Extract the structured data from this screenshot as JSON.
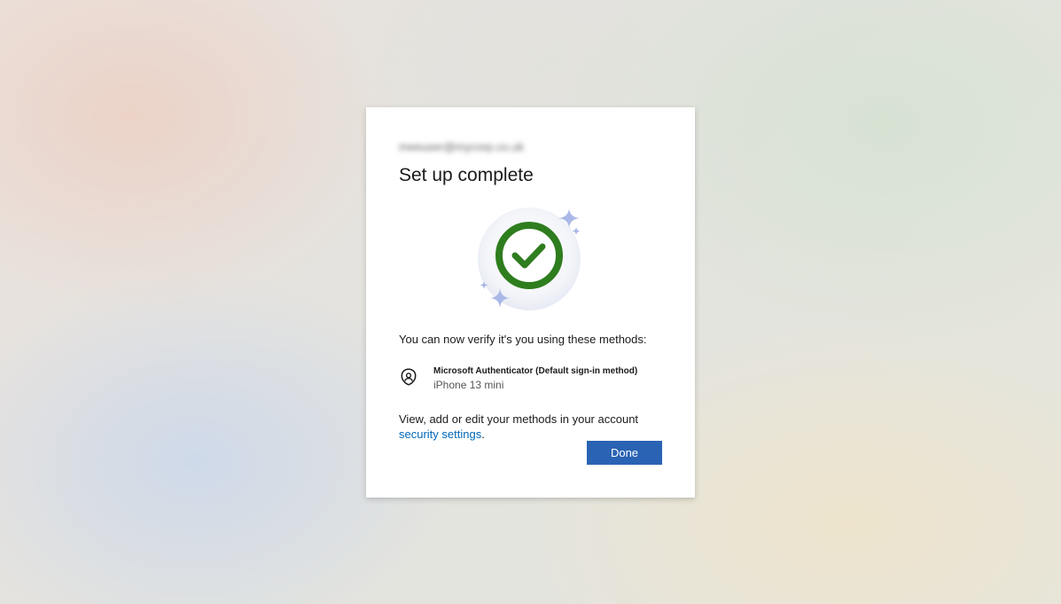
{
  "card": {
    "identity": "meeuser@mycorp.co.uk",
    "title": "Set up complete",
    "intro": "You can now verify it's you using these methods:",
    "method": {
      "name": "Microsoft Authenticator (Default sign-in method)",
      "device": "iPhone 13 mini",
      "icon": "authenticator-lock-icon"
    },
    "footer_text": "View, add or edit your methods in your account ",
    "footer_link": "security settings",
    "footer_end": ".",
    "done_label": "Done"
  },
  "colors": {
    "success_green": "#2e7d1e",
    "sparkle": "#a9b8e6",
    "button_blue": "#2a63b4",
    "link_blue": "#0067b8"
  }
}
